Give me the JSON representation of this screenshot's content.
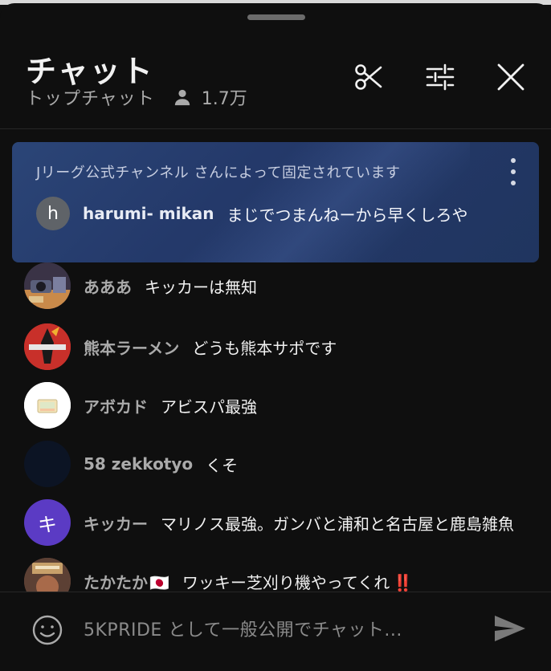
{
  "header": {
    "title": "チャット",
    "subtitle": "トップチャット",
    "viewer_count": "1.7万",
    "icons": [
      "scissors-icon",
      "filter-sliders-icon",
      "close-icon",
      "person-icon"
    ]
  },
  "pinned": {
    "note": "Jリーグ公式チャンネル さんによって固定されています",
    "avatar_letter": "h",
    "author": "harumi- mikan",
    "text": "まじでつまんねーから早くしろや"
  },
  "messages": [
    {
      "author": "あああ",
      "text": "キッカーは無知"
    },
    {
      "author": "熊本ラーメン",
      "text": "どうも熊本サポです"
    },
    {
      "author": "アボカド",
      "text": "アビスパ最強"
    },
    {
      "author": "58 zekkotyo",
      "text": "くそ"
    },
    {
      "author": "キッカー",
      "avatar_letter": "キ",
      "text": "マリノス最強。ガンバと浦和と名古屋と鹿島雑魚"
    },
    {
      "author": "たかたか",
      "author_flag": "🇯🇵",
      "text": "ワッキー芝刈り機やってくれ",
      "emphasis": "‼️"
    }
  ],
  "composer": {
    "placeholder": "5KPRIDE として一般公開でチャット...",
    "icons": [
      "emoji-icon",
      "send-icon"
    ]
  },
  "colors": {
    "background": "#0f0f0f",
    "pinned_bg": "#24396a",
    "secondary_text": "#aaaaaa",
    "kicker_avatar": "#5b3bc4"
  }
}
